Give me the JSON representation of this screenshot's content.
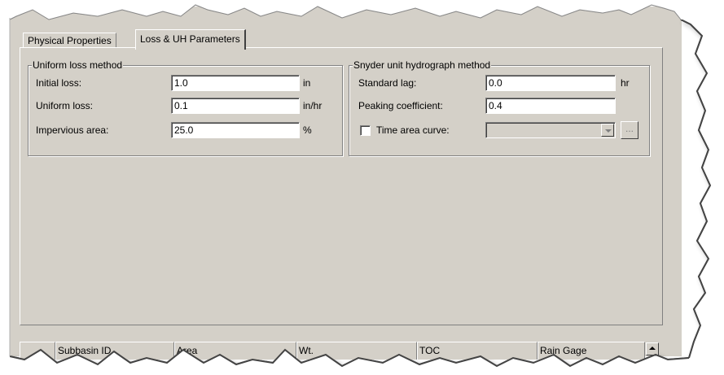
{
  "tabs": [
    {
      "label": "Physical Properties",
      "active": false
    },
    {
      "label": "Loss & UH Parameters",
      "active": true
    }
  ],
  "loss_group": {
    "title": "Uniform loss method",
    "rows": [
      {
        "label": "Initial loss:",
        "value": "1.0",
        "unit": "in"
      },
      {
        "label": "Uniform loss:",
        "value": "0.1",
        "unit": "in/hr"
      },
      {
        "label": "Impervious area:",
        "value": "25.0",
        "unit": "%"
      }
    ]
  },
  "uh_group": {
    "title": "Snyder unit hydrograph method",
    "rows": [
      {
        "label": "Standard lag:",
        "value": "0.0",
        "unit": "hr"
      },
      {
        "label": "Peaking coefficient:",
        "value": "0.4",
        "unit": ""
      }
    ],
    "time_area": {
      "label": "Time area curve:",
      "checked": false,
      "value": "",
      "browse_label": "..."
    }
  },
  "grid_columns": [
    "Subbasin ID",
    "Area",
    "Wt.",
    "TOC",
    "Rain Gage"
  ],
  "colors": {
    "face": "#d4d0c8",
    "shadow": "#808080",
    "highlight": "#ffffff",
    "dark": "#404040"
  }
}
